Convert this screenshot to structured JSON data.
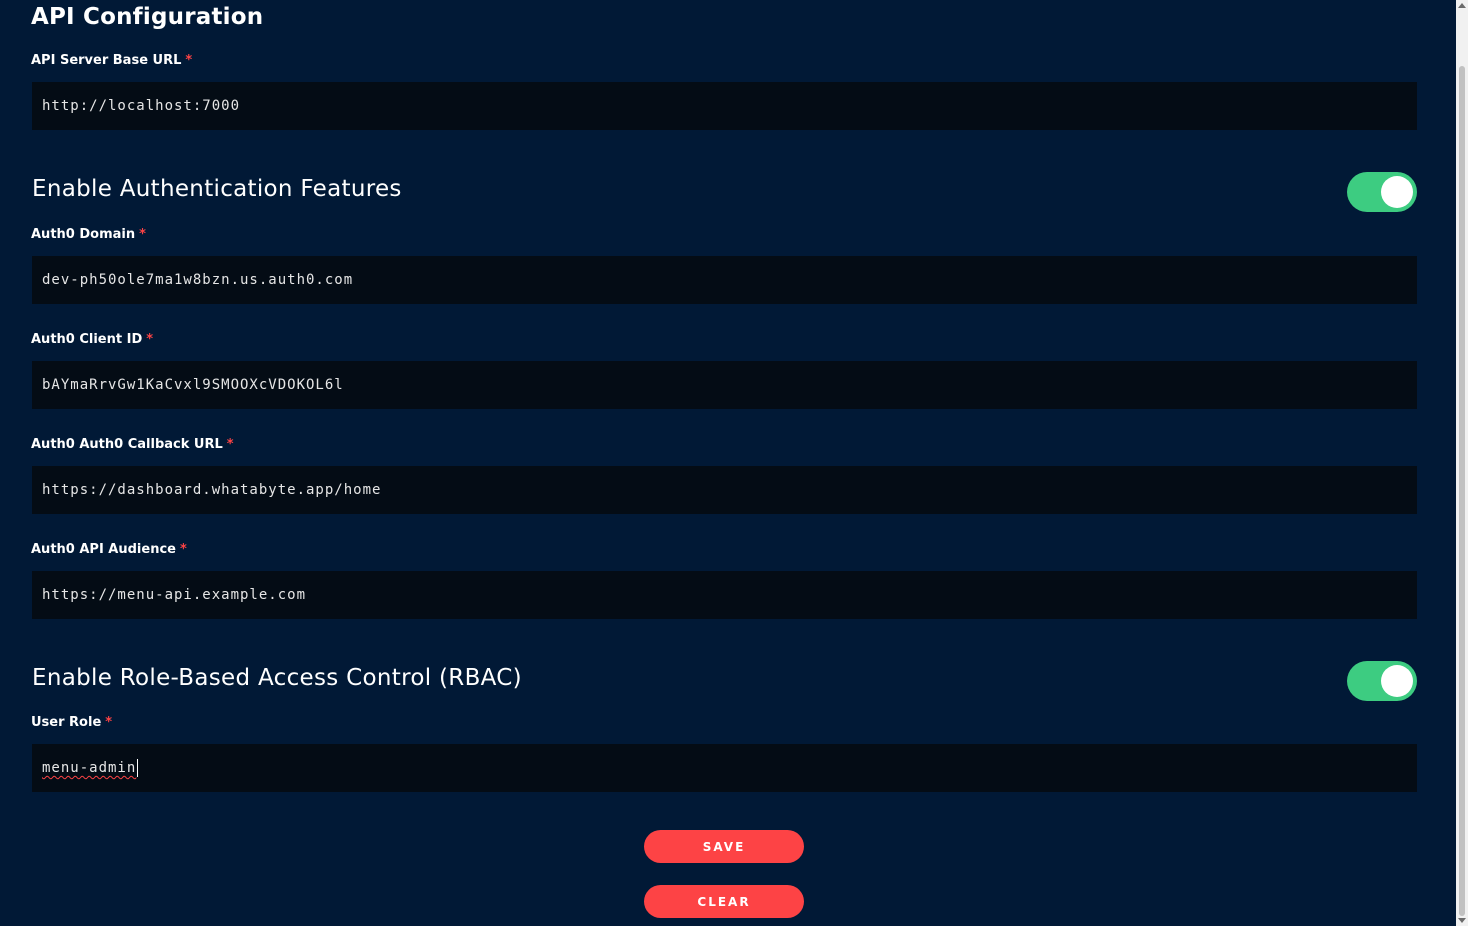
{
  "api": {
    "title": "API Configuration",
    "server_url_label": "API Server Base URL",
    "server_url_value": "http://localhost:7000"
  },
  "auth": {
    "title": "Enable Authentication Features",
    "enabled": true,
    "domain_label": "Auth0 Domain",
    "domain_value": "dev-ph50ole7ma1w8bzn.us.auth0.com",
    "client_id_label": "Auth0 Client ID",
    "client_id_value": "bAYmaRrvGw1KaCvxl9SMOOXcVDOKOL6l",
    "callback_label": "Auth0 Auth0 Callback URL",
    "callback_value": "https://dashboard.whatabyte.app/home",
    "audience_label": "Auth0 API Audience",
    "audience_value": "https://menu-api.example.com"
  },
  "rbac": {
    "title": "Enable Role-Based Access Control (RBAC)",
    "enabled": true,
    "role_label": "User Role",
    "role_value": "menu-admin"
  },
  "required_marker": "*",
  "buttons": {
    "save": "SAVE",
    "clear": "CLEAR"
  },
  "colors": {
    "background": "#011936",
    "field": "#040c15",
    "accent": "#fd4345",
    "toggle_on": "#3dcc81"
  }
}
